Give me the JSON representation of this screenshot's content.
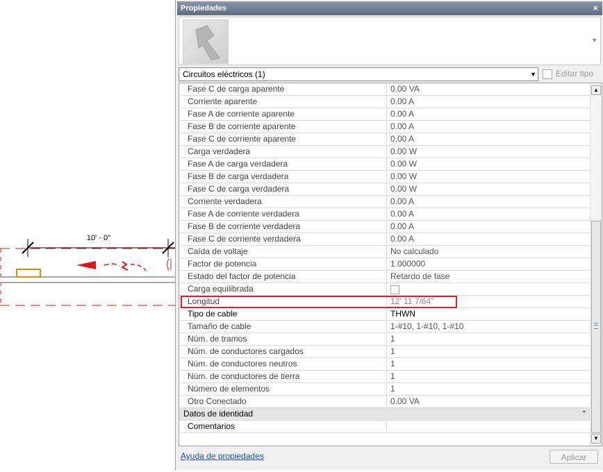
{
  "drawing": {
    "dimension_label": "10' - 0\""
  },
  "panel": {
    "title": "Propiedades",
    "close_glyph": "×",
    "type_selector": "Circuitos eléctricos (1)",
    "edit_type_label": "Editar tipo",
    "help_link": "Ayuda de propiedades",
    "apply_label": "Aplicar"
  },
  "properties": {
    "rows": [
      {
        "name": "Fase C de carga aparente",
        "value": "0.00 VA"
      },
      {
        "name": "Corriente aparente",
        "value": "0.00 A"
      },
      {
        "name": "Fase A de corriente aparente",
        "value": "0.00 A"
      },
      {
        "name": "Fase B de corriente aparente",
        "value": "0.00 A"
      },
      {
        "name": "Fase C de corriente aparente",
        "value": "0.00 A"
      },
      {
        "name": "Carga verdadera",
        "value": "0.00 W"
      },
      {
        "name": "Fase A de carga verdadera",
        "value": "0.00 W"
      },
      {
        "name": "Fase B de carga verdadera",
        "value": "0.00 W"
      },
      {
        "name": "Fase C de carga verdadera",
        "value": "0.00 W"
      },
      {
        "name": "Corriente verdadera",
        "value": "0.00 A"
      },
      {
        "name": "Fase A de corriente verdadera",
        "value": "0.00 A"
      },
      {
        "name": "Fase B de corriente verdadera",
        "value": "0.00 A"
      },
      {
        "name": "Fase C de corriente verdadera",
        "value": "0.00 A"
      },
      {
        "name": "Caída de voltaje",
        "value": "No calculado"
      },
      {
        "name": "Factor de potencia",
        "value": "1.000000"
      },
      {
        "name": "Estado del factor de potencia",
        "value": "Retardo de fase"
      },
      {
        "name": "Carga equilibrada",
        "value": ""
      },
      {
        "name": "Longitud",
        "value": "12'  11 7/64\""
      },
      {
        "name": "Tipo de cable",
        "value": "THWN"
      },
      {
        "name": "Tamaño de cable",
        "value": "1-#10, 1-#10, 1-#10"
      },
      {
        "name": "Núm. de tramos",
        "value": "1"
      },
      {
        "name": "Núm. de conductores cargados",
        "value": "1"
      },
      {
        "name": "Núm. de conductores neutros",
        "value": "1"
      },
      {
        "name": "Núm. de conductores de tierra",
        "value": "1"
      },
      {
        "name": "Número de elementos",
        "value": "1"
      },
      {
        "name": "Otro Conectado",
        "value": "0.00 VA"
      }
    ],
    "group_identity": "Datos de identidad",
    "group_collapse_glyph": "⌃",
    "comments_label": "Comentarios",
    "comments_value": ""
  },
  "icons": {
    "preview": "revit-family-icon",
    "edit_type": "edit-type-icon",
    "dropdown": "chevron-down-icon"
  },
  "colors": {
    "highlight": "#e2202a",
    "drawing_red": "#e0141e",
    "drawing_orange": "#e58a00",
    "titlebar": "#6b7890"
  }
}
